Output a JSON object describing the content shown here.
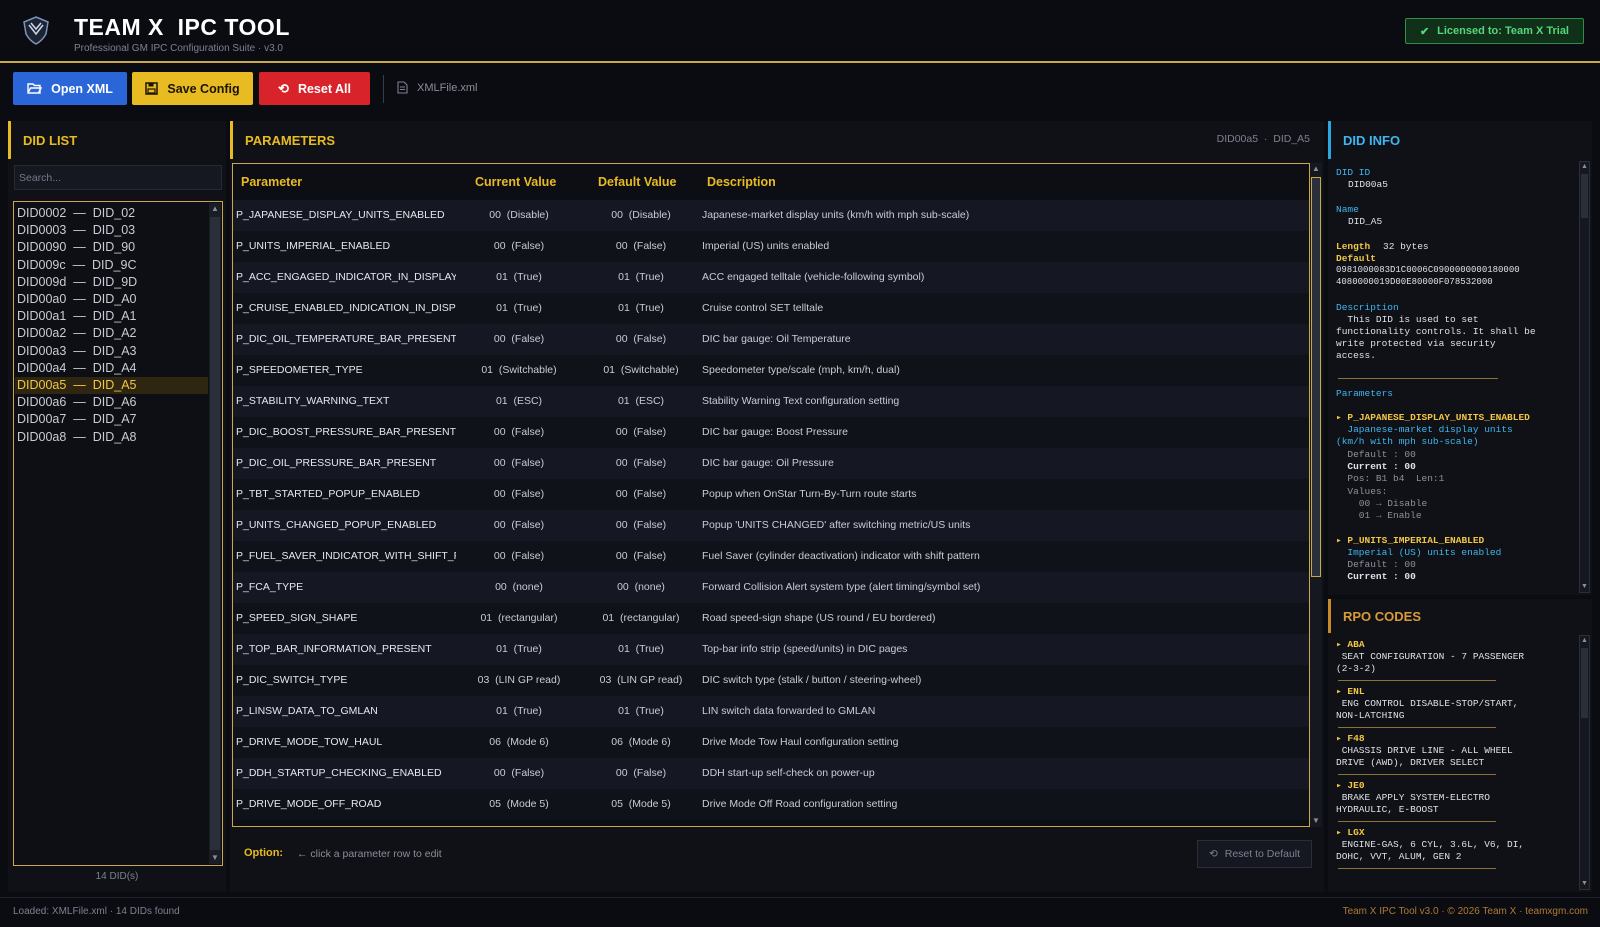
{
  "header": {
    "title": "TEAM X  IPC TOOL",
    "subtitle": "Professional GM IPC Configuration Suite  ·  v3.0",
    "license": "Licensed to: Team X Trial"
  },
  "toolbar": {
    "open_label": "Open XML",
    "save_label": "Save Config",
    "reset_label": "Reset All",
    "file_name": "XMLFile.xml"
  },
  "did_list": {
    "title": "DID LIST",
    "search_placeholder": "Search...",
    "items": [
      "DID0002  —  DID_02",
      "DID0003  —  DID_03",
      "DID0090  —  DID_90",
      "DID009c  —  DID_9C",
      "DID009d  —  DID_9D",
      "DID00a0  —  DID_A0",
      "DID00a1  —  DID_A1",
      "DID00a2  —  DID_A2",
      "DID00a3  —  DID_A3",
      "DID00a4  —  DID_A4",
      "DID00a5  —  DID_A5",
      "DID00a6  —  DID_A6",
      "DID00a7  —  DID_A7",
      "DID00a8  —  DID_A8"
    ],
    "selected": "DID00a5  —  DID_A5",
    "count": "14 DID(s)"
  },
  "parameters": {
    "title": "PARAMETERS",
    "crumb": "DID00a5  ·  DID_A5",
    "columns": [
      "Parameter",
      "Current Value",
      "Default Value",
      "Description"
    ],
    "rows": [
      {
        "name": "P_JAPANESE_DISPLAY_UNITS_ENABLED",
        "current": "00  (Disable)",
        "default": "00  (Disable)",
        "desc": "Japanese-market display units (km/h with mph sub-scale)"
      },
      {
        "name": "P_UNITS_IMPERIAL_ENABLED",
        "current": "00  (False)",
        "default": "00  (False)",
        "desc": "Imperial (US) units enabled"
      },
      {
        "name": "P_ACC_ENGAGED_INDICATOR_IN_DISPLAY",
        "current": "01  (True)",
        "default": "01  (True)",
        "desc": "ACC engaged telltale (vehicle-following symbol)"
      },
      {
        "name": "P_CRUISE_ENABLED_INDICATION_IN_DISPLAY",
        "current": "01  (True)",
        "default": "01  (True)",
        "desc": "Cruise control SET telltale"
      },
      {
        "name": "P_DIC_OIL_TEMPERATURE_BAR_PRESENT",
        "current": "00  (False)",
        "default": "00  (False)",
        "desc": "DIC bar gauge: Oil Temperature"
      },
      {
        "name": "P_SPEEDOMETER_TYPE",
        "current": "01  (Switchable)",
        "default": "01  (Switchable)",
        "desc": "Speedometer type/scale (mph, km/h, dual)"
      },
      {
        "name": "P_STABILITY_WARNING_TEXT",
        "current": "01  (ESC)",
        "default": "01  (ESC)",
        "desc": "Stability Warning Text configuration setting"
      },
      {
        "name": "P_DIC_BOOST_PRESSURE_BAR_PRESENT",
        "current": "00  (False)",
        "default": "00  (False)",
        "desc": "DIC bar gauge: Boost Pressure"
      },
      {
        "name": "P_DIC_OIL_PRESSURE_BAR_PRESENT",
        "current": "00  (False)",
        "default": "00  (False)",
        "desc": "DIC bar gauge: Oil Pressure"
      },
      {
        "name": "P_TBT_STARTED_POPUP_ENABLED",
        "current": "00  (False)",
        "default": "00  (False)",
        "desc": "Popup when OnStar Turn-By-Turn route starts"
      },
      {
        "name": "P_UNITS_CHANGED_POPUP_ENABLED",
        "current": "00  (False)",
        "default": "00  (False)",
        "desc": "Popup 'UNITS CHANGED' after switching metric/US units"
      },
      {
        "name": "P_FUEL_SAVER_INDICATOR_WITH_SHIFT_PATT",
        "current": "00  (False)",
        "default": "00  (False)",
        "desc": "Fuel Saver (cylinder deactivation) indicator with shift pattern"
      },
      {
        "name": "P_FCA_TYPE",
        "current": "00  (none)",
        "default": "00  (none)",
        "desc": "Forward Collision Alert system type (alert timing/symbol set)"
      },
      {
        "name": "P_SPEED_SIGN_SHAPE",
        "current": "01  (rectangular)",
        "default": "01  (rectangular)",
        "desc": "Road speed-sign shape (US round / EU bordered)"
      },
      {
        "name": "P_TOP_BAR_INFORMATION_PRESENT",
        "current": "01  (True)",
        "default": "01  (True)",
        "desc": "Top-bar info strip (speed/units) in DIC pages"
      },
      {
        "name": "P_DIC_SWITCH_TYPE",
        "current": "03  (LIN GP read)",
        "default": "03  (LIN GP read)",
        "desc": "DIC switch type (stalk / button / steering-wheel)"
      },
      {
        "name": "P_LINSW_DATA_TO_GMLAN",
        "current": "01  (True)",
        "default": "01  (True)",
        "desc": "LIN switch data forwarded to GMLAN"
      },
      {
        "name": "P_DRIVE_MODE_TOW_HAUL",
        "current": "06  (Mode 6)",
        "default": "06  (Mode 6)",
        "desc": "Drive Mode Tow Haul configuration setting"
      },
      {
        "name": "P_DDH_STARTUP_CHECKING_ENABLED",
        "current": "00  (False)",
        "default": "00  (False)",
        "desc": "DDH start-up self-check on power-up"
      },
      {
        "name": "P_DRIVE_MODE_OFF_ROAD",
        "current": "05  (Mode 5)",
        "default": "05  (Mode 5)",
        "desc": "Drive Mode Off Road configuration setting"
      }
    ],
    "option_label": "Option:",
    "option_hint": "← click a parameter row to edit",
    "reset_default_label": "Reset to Default"
  },
  "did_info": {
    "title": "DID INFO",
    "did_id_label": "DID ID",
    "did_id": "DID00a5",
    "name_label": "Name",
    "name": "DID_A5",
    "length_label": "Length",
    "length": "32 bytes",
    "default_label": "Default",
    "default_line1": "0981000083D1C0006C0900000000180000",
    "default_line2": "4080000019D00E80000F078532000",
    "description_label": "Description",
    "description_lines": [
      "  This DID is used to set",
      "functionality controls. It shall be",
      "write protected via security",
      "access."
    ],
    "parameters_label": "Parameters",
    "p1_name": "▸ P_JAPANESE_DISPLAY_UNITS_ENABLED",
    "p1_desc1": "  Japanese-market display units",
    "p1_desc2": "(km/h with mph sub-scale)",
    "p1_default": "  Default : 00",
    "p1_current": "  Current : 00",
    "p1_pos": "  Pos: B1 b4  Len:1",
    "p1_values": "  Values:",
    "p1_v0": "    00 → Disable",
    "p1_v1": "    01 → Enable",
    "p2_name": "▸ P_UNITS_IMPERIAL_ENABLED",
    "p2_desc": "  Imperial (US) units enabled",
    "p2_default": "  Default : 00",
    "p2_current": "  Current : 00"
  },
  "rpo": {
    "title": "RPO CODES",
    "items": [
      {
        "code": "▸ ABA",
        "lines": [
          " SEAT CONFIGURATION - 7 PASSENGER",
          "(2-3-2)"
        ]
      },
      {
        "code": "▸ ENL",
        "lines": [
          " ENG CONTROL DISABLE-STOP/START,",
          "NON-LATCHING"
        ]
      },
      {
        "code": "▸ F48",
        "lines": [
          " CHASSIS DRIVE LINE - ALL WHEEL",
          "DRIVE (AWD), DRIVER SELECT"
        ]
      },
      {
        "code": "▸ JE0",
        "lines": [
          " BRAKE APPLY SYSTEM-ELECTRO",
          "HYDRAULIC, E-BOOST"
        ]
      },
      {
        "code": "▸ LGX",
        "lines": [
          " ENGINE-GAS, 6 CYL, 3.6L, V6, DI,",
          "DOHC, VVT, ALUM, GEN 2"
        ]
      }
    ]
  },
  "status": {
    "left": "Loaded: XMLFile.xml  ·  14 DIDs found",
    "right": "Team X IPC Tool  v3.0  ·  © 2026 Team X  ·  teamxgm.com"
  },
  "colors": {
    "accent": "#e9bb22",
    "open_button": "#2a66d8",
    "reset_button": "#d9232b",
    "info_accent": "#3fb6ee",
    "license_green": "#57d67a"
  }
}
